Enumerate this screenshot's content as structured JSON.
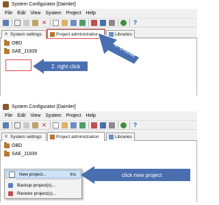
{
  "window": {
    "title": "System Configurator [Daimler]",
    "menu": [
      "File",
      "Edit",
      "View",
      "System",
      "Project",
      "Help"
    ]
  },
  "tabs": {
    "system_settings": "System settings",
    "project_administration": "Project administration",
    "libraries": "Libraries"
  },
  "tree": {
    "items": [
      "OBD",
      "SAE_J1939"
    ]
  },
  "callouts": {
    "step1": "1. choose",
    "step2": "2. right click",
    "step3": "click new project"
  },
  "context_menu": {
    "items": [
      {
        "label": "New project...",
        "shortcut": "Ins",
        "icon": "new-project-icon"
      },
      {
        "label": "Backup project(s)...",
        "shortcut": "",
        "icon": "backup-icon"
      },
      {
        "label": "Restore project(s)...",
        "shortcut": "",
        "icon": "restore-icon"
      }
    ]
  },
  "colors": {
    "highlight_red": "#e0474c",
    "callout_blue": "#4a6fb0",
    "folder": "#b7782f",
    "menu_hover": "#cfe3f7"
  },
  "toolbar_icons": [
    "save-icon",
    "cut-icon",
    "copy-icon",
    "paste-icon",
    "delete-icon",
    "new-icon",
    "import-icon",
    "export-icon",
    "print-icon",
    "settings-icon",
    "tool-icon",
    "tool2-icon",
    "refresh-icon",
    "help-icon"
  ]
}
